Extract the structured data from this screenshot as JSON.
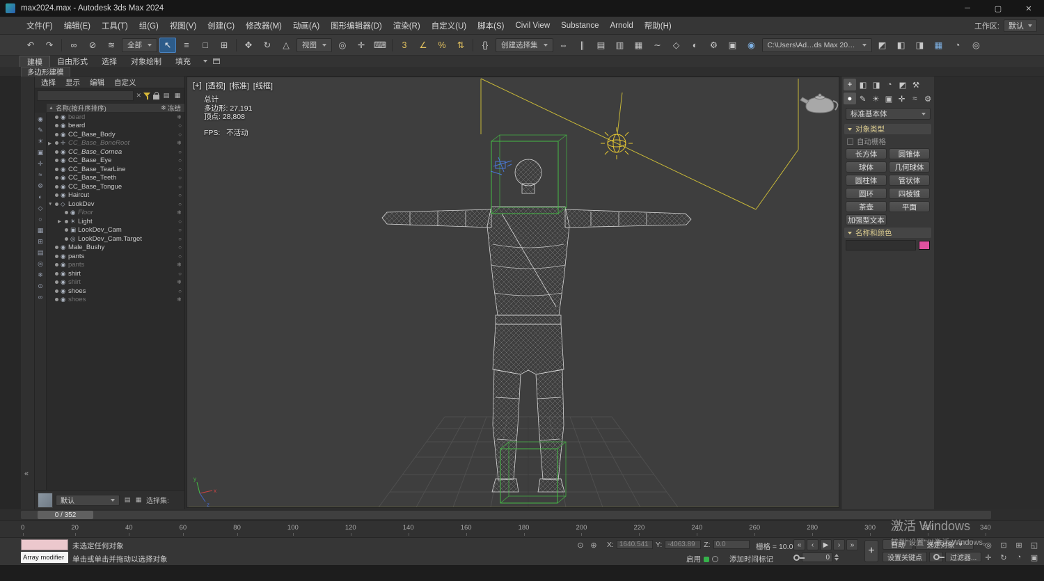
{
  "title_bar": {
    "title": "max2024.max - Autodesk 3ds Max 2024",
    "minimize": "─",
    "maximize": "▢",
    "close": "✕"
  },
  "menu_bar": {
    "items": [
      {
        "label": "文件(F)",
        "dn": "menu-file"
      },
      {
        "label": "编辑(E)",
        "dn": "menu-edit"
      },
      {
        "label": "工具(T)",
        "dn": "menu-tools"
      },
      {
        "label": "组(G)",
        "dn": "menu-group"
      },
      {
        "label": "视图(V)",
        "dn": "menu-views"
      },
      {
        "label": "创建(C)",
        "dn": "menu-create"
      },
      {
        "label": "修改器(M)",
        "dn": "menu-modifiers"
      },
      {
        "label": "动画(A)",
        "dn": "menu-animation"
      },
      {
        "label": "图形编辑器(D)",
        "dn": "menu-graph-editors"
      },
      {
        "label": "渲染(R)",
        "dn": "menu-rendering"
      },
      {
        "label": "自定义(U)",
        "dn": "menu-customize"
      },
      {
        "label": "脚本(S)",
        "dn": "menu-scripting"
      },
      {
        "label": "Civil View",
        "dn": "menu-civil-view"
      },
      {
        "label": "Substance",
        "dn": "menu-substance"
      },
      {
        "label": "Arnold",
        "dn": "menu-arnold"
      },
      {
        "label": "帮助(H)",
        "dn": "menu-help"
      }
    ],
    "workspace_label": "工作区:",
    "workspace_value": "默认"
  },
  "toolbar": {
    "items": [
      {
        "glyph": "↶",
        "dn": "undo-icon"
      },
      {
        "glyph": "↷",
        "dn": "redo-icon"
      },
      {
        "sep": true
      },
      {
        "glyph": "∞",
        "dn": "select-link-icon"
      },
      {
        "glyph": "⊘",
        "dn": "unlink-selection-icon"
      },
      {
        "glyph": "≋",
        "dn": "bind-to-space-warp-icon"
      },
      {
        "label": "全部",
        "combo": true,
        "dn": "selection-filter-dropdown"
      },
      {
        "glyph": "↖",
        "selected": true,
        "dn": "select-object-icon"
      },
      {
        "glyph": "≡",
        "dn": "select-by-name-icon"
      },
      {
        "glyph": "□",
        "dn": "rectangular-selection-icon"
      },
      {
        "glyph": "⊞",
        "dn": "window-crossing-icon"
      },
      {
        "sep": true
      },
      {
        "glyph": "✥",
        "dn": "select-and-move-icon"
      },
      {
        "glyph": "↻",
        "dn": "select-and-rotate-icon"
      },
      {
        "glyph": "△",
        "dn": "select-and-scale-icon"
      },
      {
        "label": "视图",
        "combo": true,
        "dn": "reference-coordinate-dropdown"
      },
      {
        "glyph": "◎",
        "dn": "use-pivot-center-icon"
      },
      {
        "glyph": "✛",
        "dn": "select-and-manipulate-icon"
      },
      {
        "glyph": "⌨",
        "dn": "keyboard-override-icon"
      },
      {
        "sep": true
      },
      {
        "glyph": "3",
        "accent": true,
        "dn": "snaps-toggle-icon"
      },
      {
        "glyph": "∠",
        "accent": true,
        "dn": "angle-snap-icon"
      },
      {
        "glyph": "%",
        "accent": true,
        "dn": "percent-snap-icon"
      },
      {
        "glyph": "⇅",
        "accent": true,
        "dn": "spinner-snap-icon"
      },
      {
        "sep": true
      },
      {
        "glyph": "{}",
        "dn": "edit-named-selections-icon"
      },
      {
        "label": "创建选择集",
        "combo": true,
        "dn": "named-selection-sets-dropdown"
      },
      {
        "glyph": "⇔",
        "dn": "mirror-icon"
      },
      {
        "glyph": "∥",
        "dn": "align-icon"
      },
      {
        "glyph": "▤",
        "dn": "toggle-scene-explorer-icon"
      },
      {
        "glyph": "▥",
        "dn": "toggle-layer-explorer-icon"
      },
      {
        "glyph": "▦",
        "dn": "toggle-ribbon-icon"
      },
      {
        "glyph": "∼",
        "dn": "curve-editor-icon"
      },
      {
        "glyph": "◇",
        "dn": "schematic-view-icon"
      },
      {
        "glyph": "◐",
        "dn": "material-editor-icon"
      },
      {
        "glyph": "⚙",
        "dn": "render-setup-icon"
      },
      {
        "glyph": "▣",
        "dn": "rendered-frame-window-icon"
      },
      {
        "glyph": "◉",
        "blue": true,
        "dn": "render-production-icon"
      },
      {
        "label": "C:\\Users\\Ad…ds Max 202…",
        "combo": true,
        "wide": true,
        "dn": "project-folder-dropdown"
      },
      {
        "glyph": "◩",
        "dn": "asset-tracking-icon"
      },
      {
        "glyph": "◧",
        "dn": "render-presets-icon"
      },
      {
        "glyph": "◨",
        "dn": "state-sets-icon"
      },
      {
        "glyph": "▦",
        "blue": true,
        "dn": "viewport-layouts-icon"
      },
      {
        "glyph": "◔",
        "dn": "adaptive-degradation-icon"
      },
      {
        "glyph": "◎",
        "dn": "gamma-lut-icon"
      }
    ]
  },
  "ribbon": {
    "tabs": [
      {
        "label": "建模",
        "selected": true,
        "dn": "ribbon-tab-modeling"
      },
      {
        "label": "自由形式",
        "dn": "ribbon-tab-freeform"
      },
      {
        "label": "选择",
        "dn": "ribbon-tab-selection"
      },
      {
        "label": "对象绘制",
        "dn": "ribbon-tab-object-paint"
      },
      {
        "label": "填充",
        "dn": "ribbon-tab-populate"
      }
    ],
    "subtab": "多边形建模"
  },
  "left_strip": {
    "collapse_glyph": "«"
  },
  "explorer": {
    "menus": [
      {
        "label": "选择",
        "dn": "explorer-menu-select"
      },
      {
        "label": "显示",
        "dn": "explorer-menu-display"
      },
      {
        "label": "编辑",
        "dn": "explorer-menu-edit"
      },
      {
        "label": "自定义",
        "dn": "explorer-menu-customize"
      }
    ],
    "clear_icon": "✕",
    "search_tools": [
      {
        "glyph": "▤",
        "dn": "explorer-options-icon"
      },
      {
        "glyph": "▦",
        "dn": "explorer-columns-icon"
      }
    ],
    "sort_arrow": "▲",
    "header_name": "名称(按升序排序)",
    "frozen_icon": "❄",
    "header_frozen": "冻结",
    "filters": [
      {
        "glyph": "◉",
        "dn": "filter-geometry-icon"
      },
      {
        "glyph": "✎",
        "dn": "filter-shapes-icon"
      },
      {
        "glyph": "☀",
        "dn": "filter-lights-icon"
      },
      {
        "glyph": "▣",
        "dn": "filter-cameras-icon"
      },
      {
        "glyph": "✛",
        "dn": "filter-helpers-icon"
      },
      {
        "glyph": "≈",
        "dn": "filter-space-warps-icon"
      },
      {
        "glyph": "⚙",
        "dn": "filter-systems-icon"
      },
      {
        "glyph": "◐",
        "dn": "filter-materials-icon"
      },
      {
        "glyph": "◇",
        "dn": "filter-groups-icon"
      },
      {
        "glyph": "○",
        "dn": "filter-particles-icon"
      },
      {
        "glyph": "▦",
        "dn": "filter-grids-icon"
      },
      {
        "glyph": "⊞",
        "dn": "filter-containers-icon"
      },
      {
        "glyph": "▤",
        "dn": "filter-xrefs-icon"
      },
      {
        "glyph": "◎",
        "dn": "filter-targets-icon"
      },
      {
        "glyph": "❄",
        "dn": "filter-frozen-icon"
      },
      {
        "glyph": "⊙",
        "dn": "filter-hidden-icon"
      },
      {
        "glyph": "∞",
        "dn": "filter-bones-icon"
      }
    ],
    "rows": [
      {
        "name": "beard",
        "icon": "◉",
        "dim": true,
        "right": "❄",
        "twisty": ""
      },
      {
        "name": "beard",
        "icon": "◉",
        "right": "○",
        "twisty": ""
      },
      {
        "name": "CC_Base_Body",
        "icon": "◉",
        "right": "○",
        "twisty": ""
      },
      {
        "name": "CC_Base_BoneRoot",
        "icon": "✛",
        "dim": true,
        "italic": true,
        "right": "❄",
        "twisty": "▶"
      },
      {
        "name": "CC_Base_Cornea",
        "icon": "◉",
        "italic": true,
        "right": "○",
        "twisty": ""
      },
      {
        "name": "CC_Base_Eye",
        "icon": "◉",
        "right": "○",
        "twisty": ""
      },
      {
        "name": "CC_Base_TearLine",
        "icon": "◉",
        "right": "○",
        "twisty": ""
      },
      {
        "name": "CC_Base_Teeth",
        "icon": "◉",
        "right": "○",
        "twisty": ""
      },
      {
        "name": "CC_Base_Tongue",
        "icon": "◉",
        "right": "○",
        "twisty": ""
      },
      {
        "name": "Haircut",
        "icon": "◉",
        "right": "○",
        "twisty": ""
      },
      {
        "name": "LookDev",
        "icon": "◇",
        "right": "○",
        "twisty": "▼"
      },
      {
        "name": "Floor",
        "icon": "◉",
        "dim": true,
        "italic": true,
        "child": true,
        "right": "❄",
        "twisty": ""
      },
      {
        "name": "Light",
        "icon": "☀",
        "child": true,
        "right": "○",
        "twisty": "▶"
      },
      {
        "name": "LookDev_Cam",
        "icon": "▣",
        "child": true,
        "right": "○",
        "twisty": ""
      },
      {
        "name": "LookDev_Cam.Target",
        "icon": "◎",
        "child": true,
        "right": "○",
        "twisty": ""
      },
      {
        "name": "Male_Bushy",
        "icon": "◉",
        "right": "○",
        "twisty": ""
      },
      {
        "name": "pants",
        "icon": "◉",
        "right": "○",
        "twisty": ""
      },
      {
        "name": "pants",
        "icon": "◉",
        "dim": true,
        "right": "❄",
        "twisty": ""
      },
      {
        "name": "shirt",
        "icon": "◉",
        "right": "○",
        "twisty": ""
      },
      {
        "name": "shirt",
        "icon": "◉",
        "dim": true,
        "right": "❄",
        "twisty": ""
      },
      {
        "name": "shoes",
        "icon": "◉",
        "right": "○",
        "twisty": ""
      },
      {
        "name": "shoes",
        "icon": "◉",
        "dim": true,
        "right": "❄",
        "twisty": ""
      }
    ],
    "footer": {
      "default_label": "默认",
      "selection_set_label": "选择集:"
    },
    "footer_icons": [
      {
        "glyph": "▤",
        "dn": "named-sets-icon"
      },
      {
        "glyph": "▦",
        "dn": "layers-icon"
      }
    ]
  },
  "viewport": {
    "labels": [
      {
        "label": "[+]",
        "dn": "viewport-menu-general"
      },
      {
        "label": "[透视]",
        "dn": "viewport-menu-pov"
      },
      {
        "label": "[标准]",
        "dn": "viewport-menu-standard"
      },
      {
        "label": "[线框]",
        "dn": "viewport-menu-wireframe"
      }
    ],
    "stats_lines": [
      "总计",
      "多边形: 27,191",
      "顶点: 28,808",
      "FPS:   不活动"
    ]
  },
  "command_panel": {
    "tabs1": [
      {
        "glyph": "+",
        "selected": true,
        "dn": "create-tab"
      },
      {
        "glyph": "◧",
        "dn": "modify-tab"
      },
      {
        "glyph": "◨",
        "dn": "hierarchy-tab"
      },
      {
        "glyph": "◔",
        "dn": "motion-tab"
      },
      {
        "glyph": "◩",
        "dn": "display-tab"
      },
      {
        "glyph": "⚒",
        "dn": "utilities-tab"
      }
    ],
    "tabs2": [
      {
        "glyph": "●",
        "selected": true,
        "dn": "geometry-category"
      },
      {
        "glyph": "✎",
        "dn": "shapes-category"
      },
      {
        "glyph": "☀",
        "dn": "lights-category"
      },
      {
        "glyph": "▣",
        "dn": "cameras-category"
      },
      {
        "glyph": "✛",
        "dn": "helpers-category"
      },
      {
        "glyph": "≈",
        "dn": "space-warps-category"
      },
      {
        "glyph": "⚙",
        "dn": "systems-category"
      }
    ],
    "category": "标准基本体",
    "rollout1": "对象类型",
    "autogrid": "自动栅格",
    "buttons": [
      {
        "label": "长方体",
        "dn": "create-box-button"
      },
      {
        "label": "圆锥体",
        "dn": "create-cone-button"
      },
      {
        "label": "球体",
        "dn": "create-sphere-button"
      },
      {
        "label": "几何球体",
        "dn": "create-geosphere-button"
      },
      {
        "label": "圆柱体",
        "dn": "create-cylinder-button"
      },
      {
        "label": "管状体",
        "dn": "create-tube-button"
      },
      {
        "label": "圆环",
        "dn": "create-torus-button"
      },
      {
        "label": "四棱锥",
        "dn": "create-pyramid-button"
      },
      {
        "label": "茶壶",
        "dn": "create-teapot-button"
      },
      {
        "label": "平面",
        "dn": "create-plane-button"
      }
    ],
    "text_button": "加强型文本",
    "rollout2": "名称和颜色",
    "color": "#e0519e"
  },
  "timeline": {
    "slider": "0 / 352",
    "ticks": [
      "0",
      "20",
      "40",
      "60",
      "80",
      "100",
      "120",
      "140",
      "160",
      "180",
      "200",
      "220",
      "240",
      "260",
      "280",
      "300",
      "320",
      "340"
    ]
  },
  "status": {
    "listener_text": "Array modifier",
    "prompt1": "未选定任何对象",
    "prompt2": "单击或单击并拖动以选择对象",
    "pre_icons": [
      {
        "glyph": "⊙",
        "dn": "isolate-selection-icon"
      },
      {
        "glyph": "⊕",
        "dn": "selection-lock-icon"
      }
    ],
    "x_label": "X:",
    "x_value": "1640.541",
    "y_label": "Y:",
    "y_value": "-4063.89",
    "z_label": "Z:",
    "z_value": "0.0",
    "grid": "栅格 = 10.0",
    "enable": "启用",
    "time_tag": "添加时间标记",
    "transport": [
      {
        "glyph": "«",
        "dn": "go-to-start-button"
      },
      {
        "glyph": "‹",
        "dn": "previous-frame-button"
      },
      {
        "glyph": "▶",
        "dn": "play-button"
      },
      {
        "glyph": "›",
        "dn": "next-frame-button"
      },
      {
        "glyph": "»",
        "dn": "go-to-end-button"
      }
    ],
    "spinner": "0",
    "plus_glyph": "+",
    "auto": "自动",
    "selected": "选定对象",
    "set_key": "设置关键点",
    "filters": "过滤器...",
    "nav_row1": [
      {
        "glyph": "◎",
        "dn": "zoom-extents-icon"
      },
      {
        "glyph": "⊡",
        "dn": "zoom-region-icon"
      },
      {
        "glyph": "⊞",
        "dn": "field-of-view-icon"
      },
      {
        "glyph": "◱",
        "dn": "maximize-viewport-toggle-icon"
      }
    ],
    "nav_row2": [
      {
        "glyph": "✛",
        "dn": "pan-view-icon"
      },
      {
        "glyph": "↻",
        "dn": "orbit-view-icon"
      },
      {
        "glyph": "◔",
        "dn": "zoom-icon"
      },
      {
        "glyph": "▣",
        "dn": "fullscreen-icon"
      }
    ]
  },
  "watermark": {
    "line1": "激活 Windows",
    "line2": "转到“设置”以激活 Windows。"
  }
}
